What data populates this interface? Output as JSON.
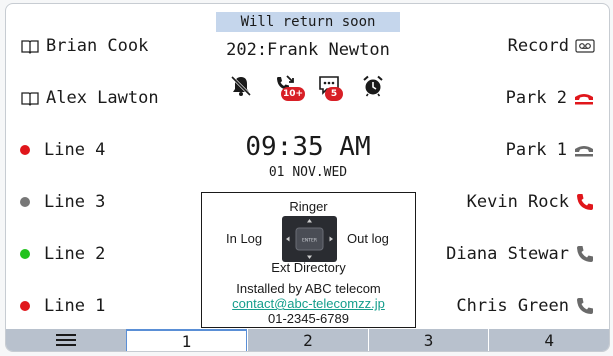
{
  "left_keys": [
    {
      "label": "Brian Cook",
      "indicator": "book-icon"
    },
    {
      "label": "Alex Lawton",
      "indicator": "book-icon"
    },
    {
      "label": "Line 4",
      "indicator": "dot",
      "color": "#e0161b"
    },
    {
      "label": "Line 3",
      "indicator": "dot",
      "color": "#777777"
    },
    {
      "label": "Line 2",
      "indicator": "dot",
      "color": "#22c21e"
    },
    {
      "label": "Line 1",
      "indicator": "dot",
      "color": "#e0161b"
    }
  ],
  "right_keys": [
    {
      "label": "Record",
      "icon": "voicemail-icon"
    },
    {
      "label": "Park 2",
      "icon": "park-active-icon"
    },
    {
      "label": "Park 1",
      "icon": "park-idle-icon"
    },
    {
      "label": "Kevin Rock",
      "icon": "handset-red-icon"
    },
    {
      "label": "Diana Stewar",
      "icon": "handset-icon"
    },
    {
      "label": "Chris Green",
      "icon": "handset-icon"
    }
  ],
  "header": {
    "banner": "Will return soon",
    "extension": "202:Frank Newton"
  },
  "status_icons": [
    {
      "name": "ringer-off-icon"
    },
    {
      "name": "missed-calls-icon",
      "badge": "10+"
    },
    {
      "name": "messages-icon",
      "badge": "5"
    },
    {
      "name": "alarm-clock-icon"
    }
  ],
  "clock": {
    "time": "09:35 AM",
    "date": "01 NOV.WED"
  },
  "guide": {
    "up": "Ringer",
    "left": "In Log",
    "right": "Out log",
    "down": "Ext Directory",
    "center": "ENTER",
    "installed_by": "Installed by ABC telecom",
    "contact": "contact@abc-telecomzz.jp",
    "phone": "01-2345-6789"
  },
  "tabs": [
    {
      "label": "",
      "icon": "menu-icon"
    },
    {
      "label": "1",
      "active": true
    },
    {
      "label": "2"
    },
    {
      "label": "3"
    },
    {
      "label": "4"
    }
  ],
  "colors": {
    "banner": "#c5d6ec",
    "tab_bg": "#b8c1cd",
    "tab_active_border": "#5a8fd6",
    "alert_red": "#e0161b",
    "link": "#159e8c"
  }
}
